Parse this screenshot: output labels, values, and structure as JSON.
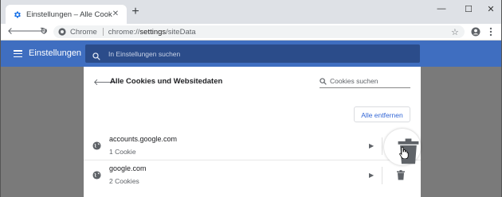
{
  "tab": {
    "title": "Einstellungen – Alle Cookies und",
    "close": "✕",
    "new": "+"
  },
  "window_controls": {
    "minimize": "—",
    "maximize": "☐",
    "close": "✕"
  },
  "toolbar": {
    "chrome_label": "Chrome",
    "url_scheme": "chrome://",
    "url_path_strong": "settings",
    "url_rest": "/siteData"
  },
  "header": {
    "title": "Einstellungen",
    "search_placeholder": "In Einstellungen suchen"
  },
  "card": {
    "title": "Alle Cookies und Websitedaten",
    "search_placeholder": "Cookies suchen",
    "remove_all": "Alle entfernen",
    "sites": [
      {
        "name": "accounts.google.com",
        "count": "1 Cookie"
      },
      {
        "name": "google.com",
        "count": "2 Cookies"
      }
    ]
  },
  "colors": {
    "accent": "#3f6ec0",
    "link": "#3367d6"
  }
}
